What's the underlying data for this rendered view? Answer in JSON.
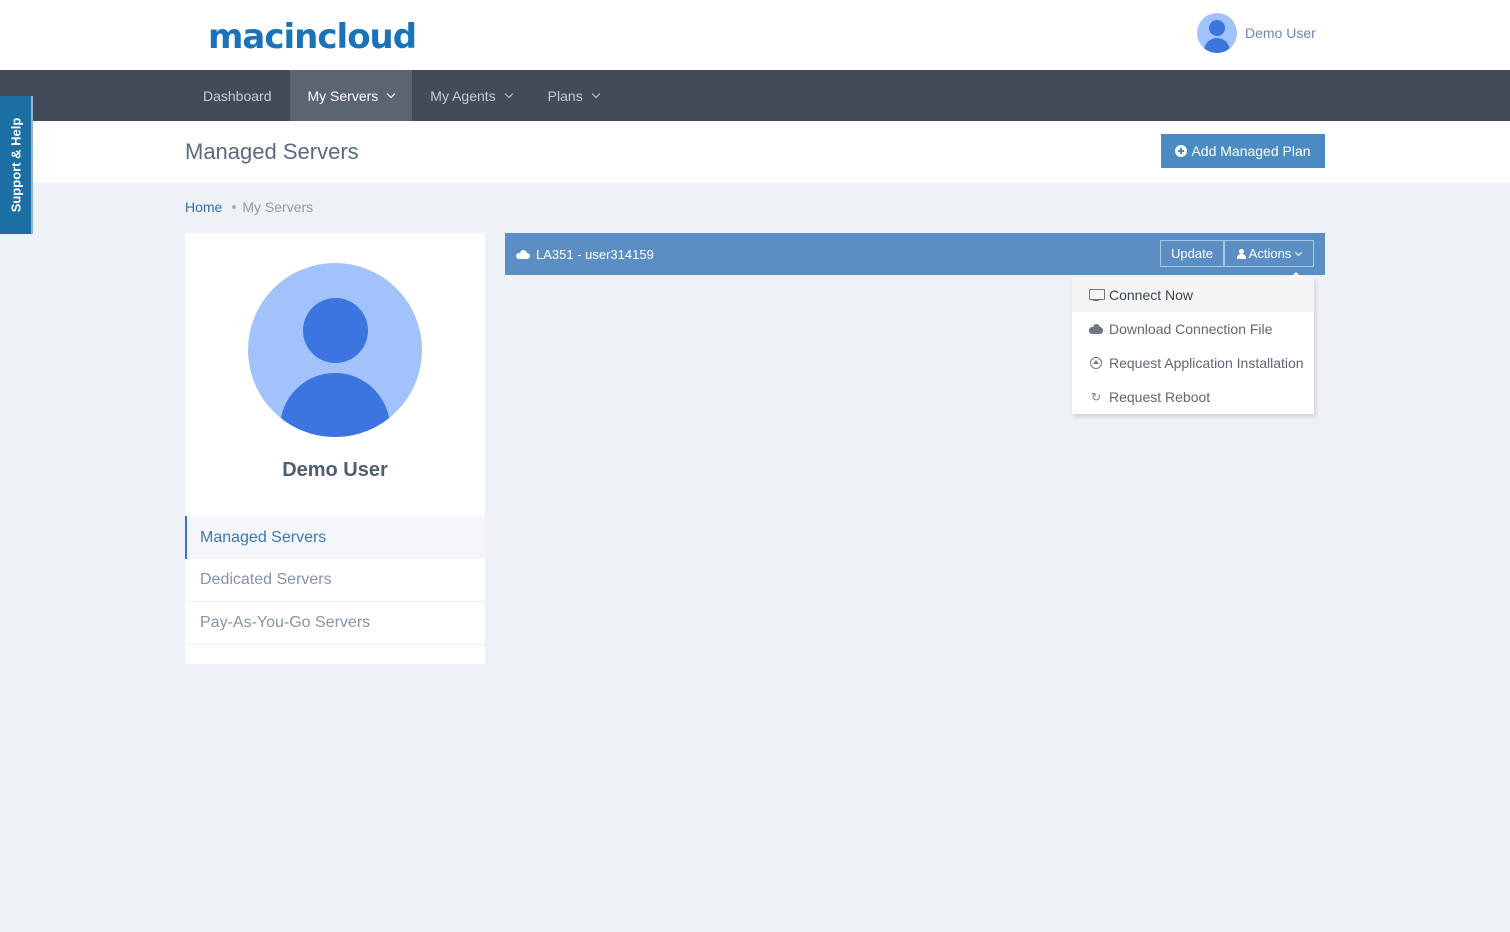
{
  "header": {
    "logo_text": "macincloud",
    "user_name": "Demo User"
  },
  "nav": {
    "items": [
      {
        "label": "Dashboard",
        "has_dropdown": false,
        "active": false
      },
      {
        "label": "My Servers",
        "has_dropdown": true,
        "active": true
      },
      {
        "label": "My Agents",
        "has_dropdown": true,
        "active": false
      },
      {
        "label": "Plans",
        "has_dropdown": true,
        "active": false
      }
    ]
  },
  "support_tab": {
    "label": "Support & Help"
  },
  "page": {
    "title": "Managed Servers",
    "add_plan_label": "Add Managed Plan"
  },
  "breadcrumb": {
    "home": "Home",
    "current": "My Servers"
  },
  "profile": {
    "name": "Demo User",
    "menu": [
      {
        "label": "Managed Servers",
        "active": true
      },
      {
        "label": "Dedicated Servers",
        "active": false
      },
      {
        "label": "Pay-As-You-Go Servers",
        "active": false
      }
    ]
  },
  "server": {
    "name": "LA351 - user314159",
    "update_label": "Update",
    "actions_label": "Actions",
    "dropdown": [
      {
        "label": "Connect Now",
        "icon": "monitor-icon"
      },
      {
        "label": "Download Connection File",
        "icon": "cloud-download-icon"
      },
      {
        "label": "Request Application Installation",
        "icon": "arrow-circle-up-icon"
      },
      {
        "label": "Request Reboot",
        "icon": "refresh-icon"
      }
    ]
  },
  "colors": {
    "brand": "#1a73b8",
    "navbar": "#434b58",
    "server_bar": "#5b8fc4",
    "primary_button": "#4a8bc2",
    "avatar_light": "#a1c2fa",
    "avatar_dark": "#3c75e0"
  }
}
